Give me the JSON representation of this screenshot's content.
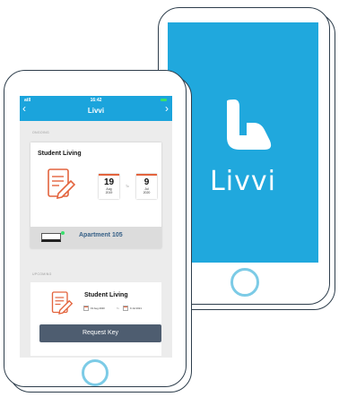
{
  "splash": {
    "app_name": "Livvi",
    "brand_color": "#20a8dd"
  },
  "status_bar": {
    "signal": "atll",
    "time": "16:42"
  },
  "nav": {
    "title": "Livvi",
    "back_icon": "chevron-left-icon",
    "forward_icon": "chevron-right-icon"
  },
  "ongoing": {
    "section_label": "ONGOING",
    "title": "Student Living",
    "start": {
      "day": "19",
      "month": "Aug",
      "year": "2019"
    },
    "to_label": "To",
    "end": {
      "day": "9",
      "month": "Jul",
      "year": "2020"
    },
    "apartment": "Apartment 105"
  },
  "upcoming": {
    "section_label": "UPCOMING",
    "title": "Student Living",
    "start_date": "19 Aug 2020",
    "to_label": "To",
    "end_date": "9 Jul 2021",
    "button_label": "Request Key"
  },
  "colors": {
    "accent": "#1ba4dc",
    "doc_icon": "#e3643e",
    "apartment_text": "#355f86",
    "button": "#4e5d70"
  }
}
